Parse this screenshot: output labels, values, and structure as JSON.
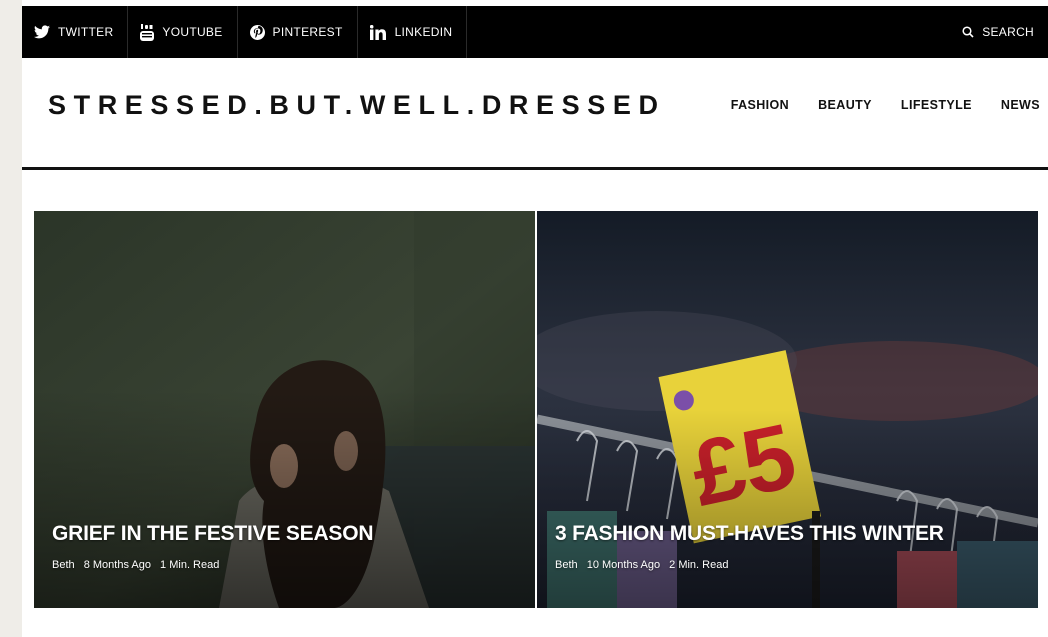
{
  "social": [
    {
      "label": "TWITTER",
      "icon": "twitter-icon"
    },
    {
      "label": "YOUTUBE",
      "icon": "youtube-icon"
    },
    {
      "label": "PINTEREST",
      "icon": "pinterest-icon"
    },
    {
      "label": "LINKEDIN",
      "icon": "linkedin-icon"
    }
  ],
  "search": {
    "label": "SEARCH",
    "icon": "search-icon"
  },
  "site": {
    "logo": "STRESSED.BUT.WELL.DRESSED"
  },
  "nav": [
    "FASHION",
    "BEAUTY",
    "LIFESTYLE",
    "NEWS"
  ],
  "posts": [
    {
      "title": "GRIEF IN THE FESTIVE SEASON",
      "author": "Beth",
      "time": "8 Months Ago",
      "read": "1 Min. Read"
    },
    {
      "title": "3 FASHION MUST-HAVES THIS WINTER",
      "author": "Beth",
      "time": "10 Months Ago",
      "read": "2 Min. Read",
      "sign_text": "£5"
    }
  ],
  "colors": {
    "topbar": "#000000",
    "text_dark": "#111111",
    "overlay_text": "#ffffff",
    "sign_yellow": "#e8d23a",
    "sign_red": "#c8202a"
  }
}
